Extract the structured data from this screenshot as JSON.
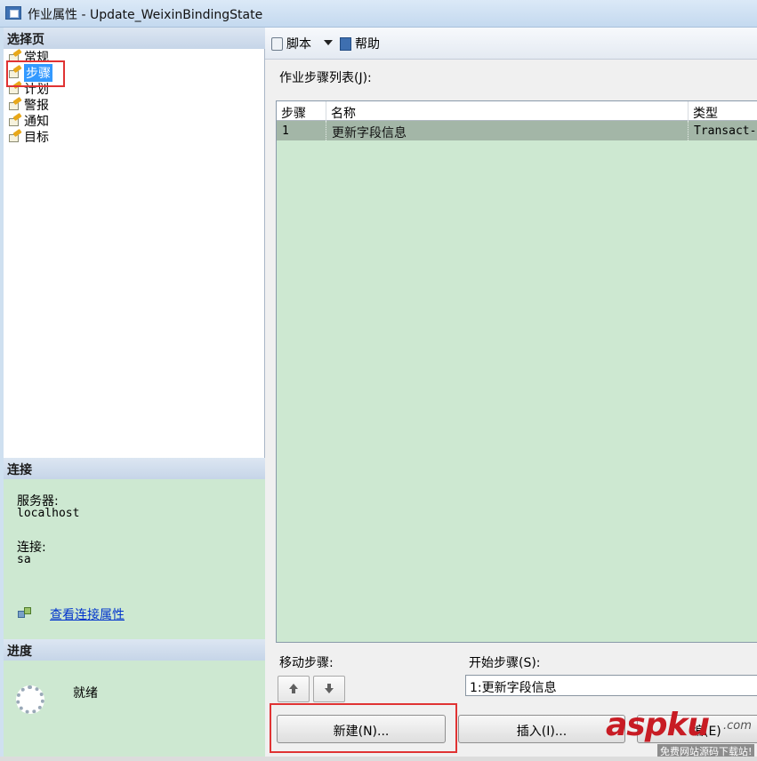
{
  "window": {
    "title": "作业属性 - Update_WeixinBindingState"
  },
  "left": {
    "select_page_header": "选择页",
    "pages": [
      {
        "label": "常规",
        "icon": "page-wrench-icon"
      },
      {
        "label": "步骤",
        "icon": "page-wrench-icon",
        "selected": true
      },
      {
        "label": "计划",
        "icon": "page-wrench-icon"
      },
      {
        "label": "警报",
        "icon": "page-wrench-icon"
      },
      {
        "label": "通知",
        "icon": "page-wrench-icon"
      },
      {
        "label": "目标",
        "icon": "page-wrench-icon"
      }
    ],
    "connection": {
      "header": "连接",
      "server_label": "服务器:",
      "server_value": "localhost",
      "conn_label": "连接:",
      "conn_value": "sa",
      "view_link": "查看连接属性"
    },
    "progress": {
      "header": "进度",
      "status": "就绪"
    }
  },
  "toolbar": {
    "script_label": "脚本",
    "help_label": "帮助"
  },
  "steps": {
    "list_label": "作业步骤列表(J):",
    "columns": [
      "步骤",
      "名称",
      "类型"
    ],
    "rows": [
      {
        "step": "1",
        "name": "更新字段信息",
        "type": "Transact-"
      }
    ],
    "move_label": "移动步骤:",
    "start_label": "开始步骤(S):",
    "start_value": "1:更新字段信息",
    "new_button": "新建(N)...",
    "insert_button": "插入(I)...",
    "edit_button_partial": "编(E)"
  },
  "watermark": {
    "brand": "aspku",
    "dotcom": ".com",
    "tagline": "免费网站源码下载站!"
  },
  "colors": {
    "selection": "#3399ff",
    "grid_bg": "#cde8d1",
    "row_selected": "#a3b6a7",
    "highlight_box": "#e03333",
    "link": "#0033cc"
  }
}
